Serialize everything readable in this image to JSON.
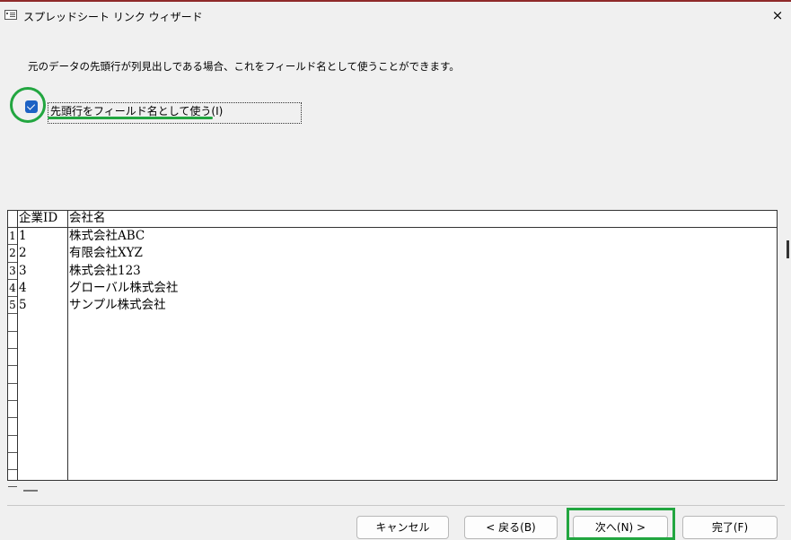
{
  "window": {
    "title": "スプレッドシート リンク ウィザード",
    "close": "×"
  },
  "description": "元のデータの先頭行が列見出しである場合、これをフィールド名として使うことができます。",
  "checkbox": {
    "label": "先頭行をフィールド名として使う(I)",
    "checked": true
  },
  "grid": {
    "columns": [
      "企業ID",
      "会社名"
    ],
    "rows": [
      {
        "num": "1",
        "id": "1",
        "name": "株式会社ABC"
      },
      {
        "num": "2",
        "id": "2",
        "name": "有限会社XYZ"
      },
      {
        "num": "3",
        "id": "3",
        "name": "株式会社123"
      },
      {
        "num": "4",
        "id": "4",
        "name": "グローバル株式会社"
      },
      {
        "num": "5",
        "id": "5",
        "name": "サンプル株式会社"
      }
    ]
  },
  "buttons": {
    "cancel": "キャンセル",
    "back": "< 戻る(B)",
    "next": "次へ(N) >",
    "finish": "完了(F)"
  },
  "colors": {
    "highlight": "#22a640",
    "checkbox": "#1d62c4",
    "titlebar_accent": "#8f2a2a"
  }
}
